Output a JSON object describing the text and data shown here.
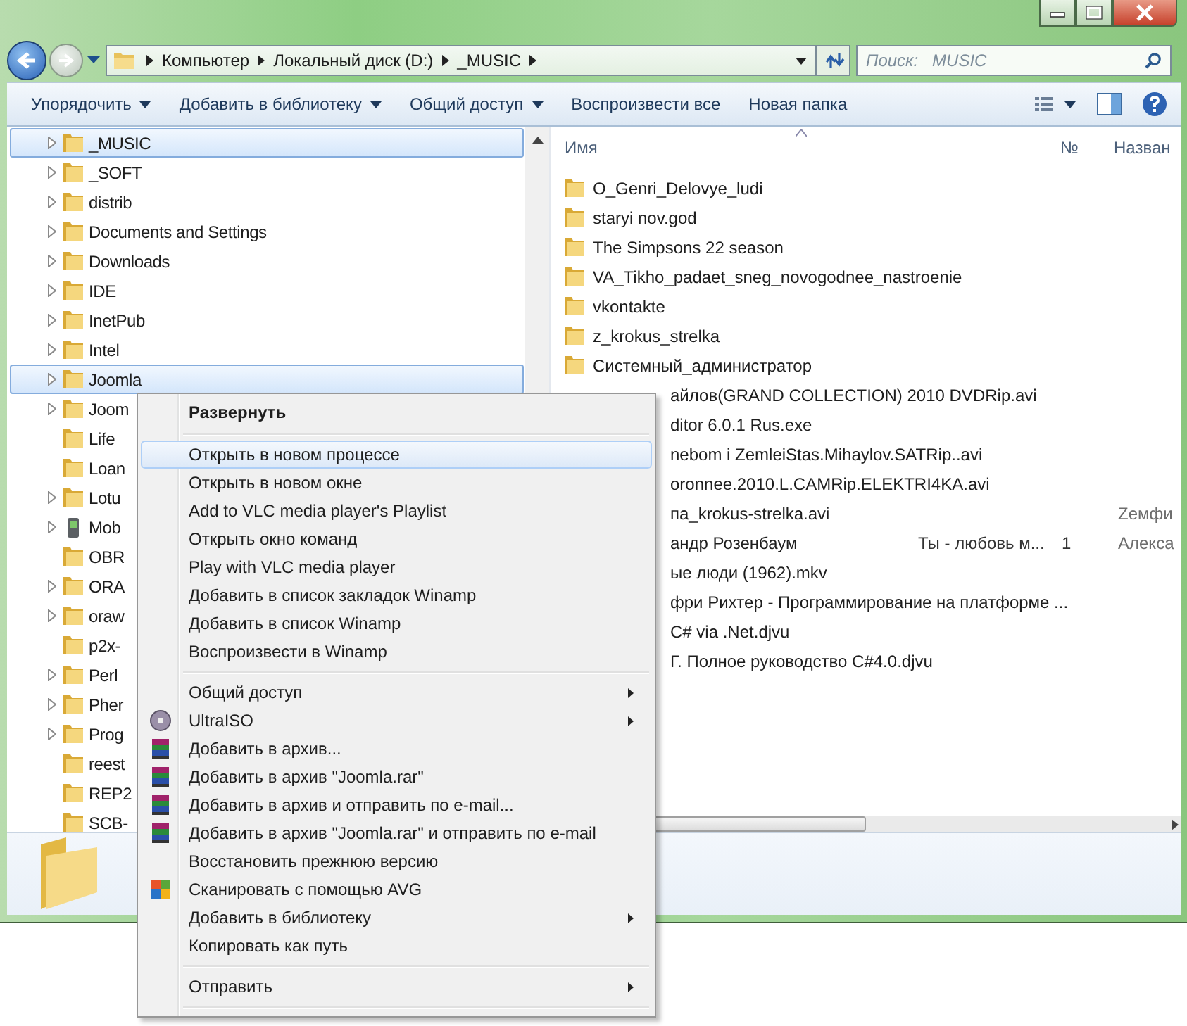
{
  "address": {
    "crumbs": [
      "Компьютер",
      "Локальный диск (D:)",
      "_MUSIC"
    ]
  },
  "search": {
    "placeholder": "Поиск: _MUSIC"
  },
  "toolbar": [
    {
      "label": "Упорядочить",
      "dropdown": true
    },
    {
      "label": "Добавить в библиотеку",
      "dropdown": true
    },
    {
      "label": "Общий доступ",
      "dropdown": true
    },
    {
      "label": "Воспроизвести все",
      "dropdown": false
    },
    {
      "label": "Новая папка",
      "dropdown": false
    }
  ],
  "tree": [
    {
      "label": "_MUSIC",
      "kind": "folder",
      "expandable": true,
      "selected": true
    },
    {
      "label": "_SOFT",
      "kind": "folder",
      "expandable": true,
      "selected": false
    },
    {
      "label": "distrib",
      "kind": "folder",
      "expandable": true,
      "selected": false
    },
    {
      "label": "Documents and Settings",
      "kind": "folder",
      "expandable": true,
      "selected": false
    },
    {
      "label": "Downloads",
      "kind": "folder",
      "expandable": true,
      "selected": false
    },
    {
      "label": "IDE",
      "kind": "folder",
      "expandable": true,
      "selected": false
    },
    {
      "label": "InetPub",
      "kind": "folder",
      "expandable": true,
      "selected": false
    },
    {
      "label": "Intel",
      "kind": "folder",
      "expandable": true,
      "selected": false
    },
    {
      "label": "Joomla",
      "kind": "folder",
      "expandable": true,
      "selected": true
    },
    {
      "label": "Joom",
      "kind": "folder",
      "expandable": true,
      "selected": false
    },
    {
      "label": "Life",
      "kind": "folder",
      "expandable": false,
      "selected": false
    },
    {
      "label": "Loan",
      "kind": "folder",
      "expandable": false,
      "selected": false
    },
    {
      "label": "Lotu",
      "kind": "folder",
      "expandable": true,
      "selected": false
    },
    {
      "label": "Mob",
      "kind": "device",
      "expandable": true,
      "selected": false
    },
    {
      "label": "OBR",
      "kind": "folder",
      "expandable": false,
      "selected": false
    },
    {
      "label": "ORA",
      "kind": "folder",
      "expandable": true,
      "selected": false
    },
    {
      "label": "oraw",
      "kind": "folder",
      "expandable": true,
      "selected": false
    },
    {
      "label": "p2x-",
      "kind": "folder",
      "expandable": false,
      "selected": false
    },
    {
      "label": "Perl",
      "kind": "folder",
      "expandable": true,
      "selected": false
    },
    {
      "label": "Pher",
      "kind": "folder",
      "expandable": true,
      "selected": false
    },
    {
      "label": "Prog",
      "kind": "folder",
      "expandable": true,
      "selected": false
    },
    {
      "label": "reest",
      "kind": "folder",
      "expandable": false,
      "selected": false
    },
    {
      "label": "REP2",
      "kind": "folder",
      "expandable": false,
      "selected": false
    },
    {
      "label": "SCB-",
      "kind": "folder",
      "expandable": false,
      "selected": false
    }
  ],
  "files": {
    "columns": [
      "Имя",
      "№",
      "Назван"
    ],
    "rows": [
      {
        "kind": "folder",
        "name": "O_Genri_Delovye_ludi"
      },
      {
        "kind": "folder",
        "name": "staryi nov.god"
      },
      {
        "kind": "folder",
        "name": "The Simpsons 22 season"
      },
      {
        "kind": "folder",
        "name": "VA_Tikho_padaet_sneg_novogodnee_nastroenie"
      },
      {
        "kind": "folder",
        "name": "vkontakte"
      },
      {
        "kind": "folder",
        "name": "z_krokus_strelka"
      },
      {
        "kind": "folder",
        "name": "Системный_администратор"
      },
      {
        "kind": "file",
        "name": "айлов(GRAND COLLECTION) 2010 DVDRip.avi"
      },
      {
        "kind": "file",
        "name": "ditor 6.0.1 Rus.exe"
      },
      {
        "kind": "file",
        "name": "nebom i ZemleiStas.Mihaylov.SATRip..avi"
      },
      {
        "kind": "file",
        "name": "oronnee.2010.L.CAMRip.ELEKTRI4KA.avi"
      },
      {
        "kind": "file",
        "name": "па_krokus-strelka.avi",
        "artist": "Zемфи"
      },
      {
        "kind": "file",
        "name": "андр Розенбаум",
        "title": "Ты - любовь м...",
        "number": "1",
        "artist": "Алекса"
      },
      {
        "kind": "file",
        "name": "ые люди (1962).mkv"
      },
      {
        "kind": "file",
        "name": "фри Рихтер - Программирование на платформе ..."
      },
      {
        "kind": "file",
        "name": "C# via .Net.djvu"
      },
      {
        "kind": "file",
        "name": "Г. Полное руководство C#4.0.djvu"
      }
    ]
  },
  "context_menu": [
    {
      "kind": "item",
      "label": "Развернуть",
      "default": true,
      "selected": false,
      "submenu": false
    },
    {
      "kind": "separator"
    },
    {
      "kind": "item",
      "label": "Открыть в новом процессе",
      "selected": true,
      "submenu": false
    },
    {
      "kind": "item",
      "label": "Открыть в новом окне",
      "selected": false,
      "submenu": false
    },
    {
      "kind": "item",
      "label": "Add to VLC media player's Playlist",
      "selected": false,
      "submenu": false
    },
    {
      "kind": "item",
      "label": "Открыть окно команд",
      "selected": false,
      "submenu": false
    },
    {
      "kind": "item",
      "label": "Play with VLC media player",
      "selected": false,
      "submenu": false
    },
    {
      "kind": "item",
      "label": "Добавить в список закладок Winamp",
      "selected": false,
      "submenu": false
    },
    {
      "kind": "item",
      "label": "Добавить в список Winamp",
      "selected": false,
      "submenu": false
    },
    {
      "kind": "item",
      "label": "Воспроизвести в Winamp",
      "selected": false,
      "submenu": false
    },
    {
      "kind": "separator"
    },
    {
      "kind": "item",
      "label": "Общий доступ",
      "selected": false,
      "submenu": true
    },
    {
      "kind": "disc",
      "label": "UltraISO",
      "selected": false,
      "submenu": true
    },
    {
      "kind": "archive",
      "label": "Добавить в архив...",
      "selected": false,
      "submenu": false
    },
    {
      "kind": "archive",
      "label": "Добавить в архив \"Joomla.rar\"",
      "selected": false,
      "submenu": false
    },
    {
      "kind": "archive",
      "label": "Добавить в архив и отправить по e-mail...",
      "selected": false,
      "submenu": false
    },
    {
      "kind": "archive",
      "label": "Добавить в архив \"Joomla.rar\" и отправить по e-mail",
      "selected": false,
      "submenu": false
    },
    {
      "kind": "item",
      "label": "Восстановить прежнюю версию",
      "selected": false,
      "submenu": false
    },
    {
      "kind": "scan",
      "label": "Сканировать с помощью AVG",
      "selected": false,
      "submenu": false
    },
    {
      "kind": "item",
      "label": "Добавить в библиотеку",
      "selected": false,
      "submenu": true
    },
    {
      "kind": "item",
      "label": "Копировать как путь",
      "selected": false,
      "submenu": false
    },
    {
      "kind": "separator"
    },
    {
      "kind": "item",
      "label": "Отправить",
      "selected": false,
      "submenu": true
    },
    {
      "kind": "separator"
    }
  ]
}
